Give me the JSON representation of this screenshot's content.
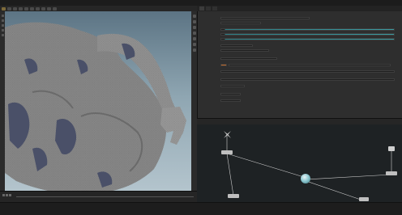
{
  "menubar": {
    "items": [
      "",
      "",
      "",
      "",
      "",
      "",
      "",
      "",
      "",
      "",
      "",
      "",
      "",
      "",
      "",
      "",
      "",
      "",
      "",
      "",
      "",
      "",
      "",
      "",
      "",
      ""
    ]
  },
  "viewport": {
    "label": "",
    "background": "#8fa6b2"
  },
  "right_tabs": [
    "",
    "",
    "",
    "",
    ""
  ],
  "params": {
    "rows": [
      "",
      "",
      "",
      "",
      "",
      "",
      "",
      "",
      "",
      "",
      "",
      ""
    ]
  },
  "network": {
    "tabs": [
      "",
      "",
      "",
      "",
      "",
      "",
      "",
      ""
    ],
    "nodes": [
      "",
      "",
      "",
      "",
      ""
    ]
  },
  "colors": {
    "accent_teal": "#3b9aa0",
    "accent_orange": "#c06a2a",
    "node_gray": "#bfbfbf",
    "mesh_gray": "#8a8a8a",
    "cloth_blue": "#4a5068"
  }
}
